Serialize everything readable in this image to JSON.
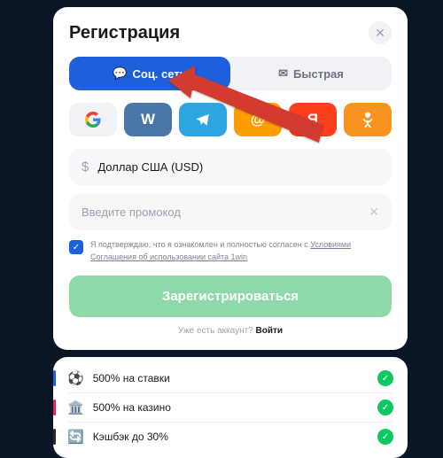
{
  "header": {
    "title": "Регистрация"
  },
  "tabs": {
    "social": "Соц. сети",
    "fast": "Быстрая"
  },
  "currency": {
    "label": "Доллар США (USD)"
  },
  "promo": {
    "placeholder": "Введите промокод"
  },
  "agree": {
    "prefix": "Я подтверждаю, что я ознакомлен и полностью согласен с ",
    "link": "Условиями Соглашения об использовании сайта 1win"
  },
  "register_label": "Зарегистрироваться",
  "login": {
    "prefix": "Уже есть аккаунт? ",
    "link": "Войти"
  },
  "bonuses": [
    {
      "text": "500% на ставки"
    },
    {
      "text": "500% на казино"
    },
    {
      "text": "Кэшбэк до 30%"
    }
  ]
}
